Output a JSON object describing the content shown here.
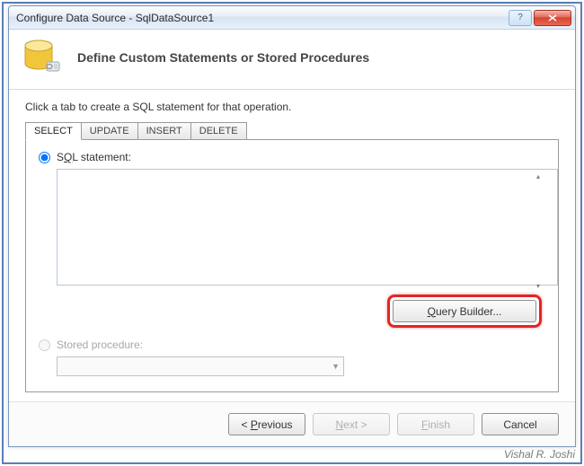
{
  "window": {
    "title": "Configure Data Source - SqlDataSource1"
  },
  "header": {
    "title": "Define Custom Statements or Stored Procedures"
  },
  "instruction": "Click a tab to create a SQL statement for that operation.",
  "tabs": [
    {
      "label": "SELECT",
      "active": true
    },
    {
      "label": "UPDATE",
      "active": false
    },
    {
      "label": "INSERT",
      "active": false
    },
    {
      "label": "DELETE",
      "active": false
    }
  ],
  "options": {
    "sql_radio_label": "SQL statement:",
    "sql_value": "",
    "stored_radio_label": "Stored procedure:",
    "stored_selected": "",
    "query_builder_label": "Query Builder..."
  },
  "footer": {
    "previous": "< Previous",
    "next": "Next >",
    "finish": "Finish",
    "cancel": "Cancel"
  },
  "watermark": "Vishal R. Joshi"
}
